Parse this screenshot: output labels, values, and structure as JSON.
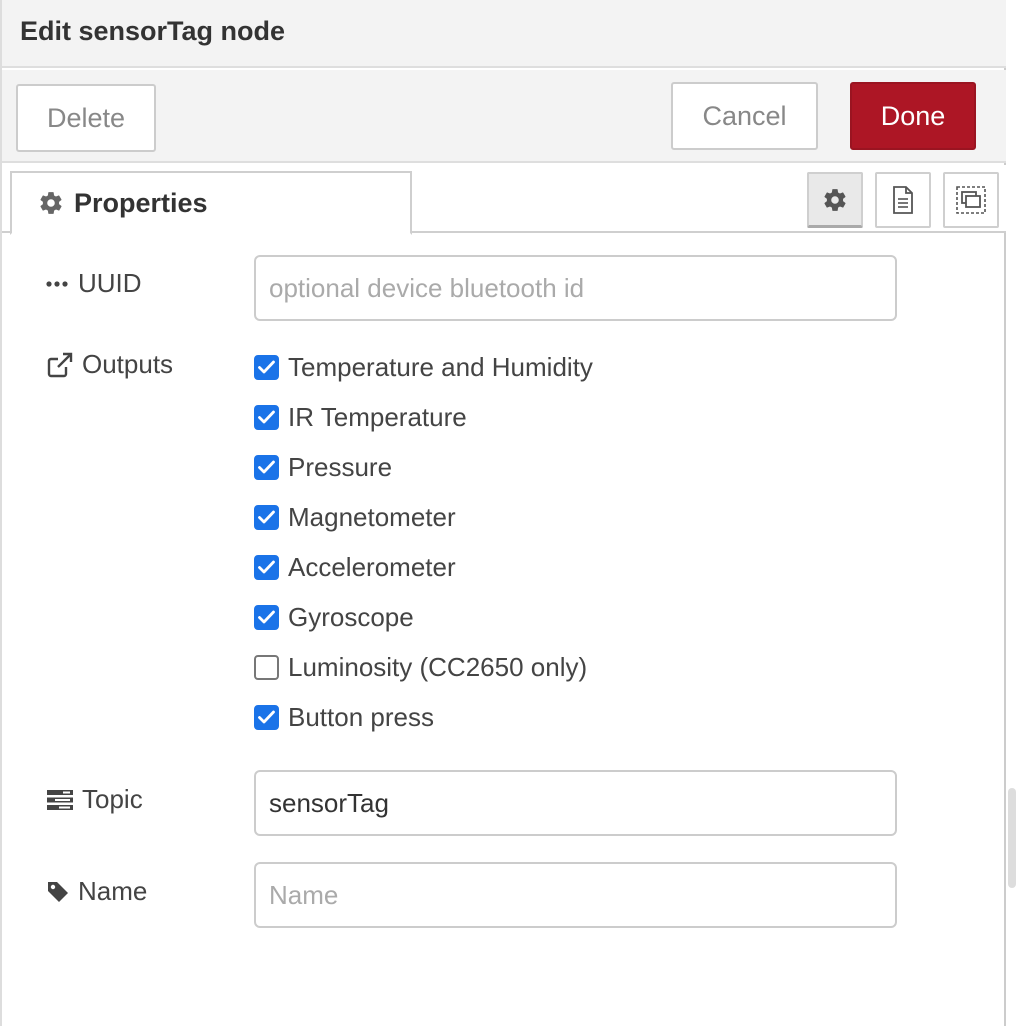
{
  "header": {
    "title": "Edit sensorTag node"
  },
  "toolbar": {
    "delete_label": "Delete",
    "cancel_label": "Cancel",
    "done_label": "Done"
  },
  "tabs": {
    "properties_label": "Properties",
    "icons": [
      "gear-icon",
      "document-icon",
      "appearance-icon"
    ]
  },
  "form": {
    "uuid": {
      "label": "UUID",
      "icon": "ellipsis-icon",
      "value": "",
      "placeholder": "optional device bluetooth id"
    },
    "outputs": {
      "label": "Outputs",
      "icon": "external-link-icon",
      "options": [
        {
          "label": "Temperature and Humidity",
          "checked": true
        },
        {
          "label": "IR Temperature",
          "checked": true
        },
        {
          "label": "Pressure",
          "checked": true
        },
        {
          "label": "Magnetometer",
          "checked": true
        },
        {
          "label": "Accelerometer",
          "checked": true
        },
        {
          "label": "Gyroscope",
          "checked": true
        },
        {
          "label": "Luminosity (CC2650 only)",
          "checked": false
        },
        {
          "label": "Button press",
          "checked": true
        }
      ]
    },
    "topic": {
      "label": "Topic",
      "icon": "tasks-icon",
      "value": "sensorTag",
      "placeholder": ""
    },
    "name": {
      "label": "Name",
      "icon": "tag-icon",
      "value": "",
      "placeholder": "Name"
    }
  },
  "colors": {
    "done": "#ad1625",
    "checkbox": "#1a73e8",
    "header_bg": "#f3f3f3"
  }
}
